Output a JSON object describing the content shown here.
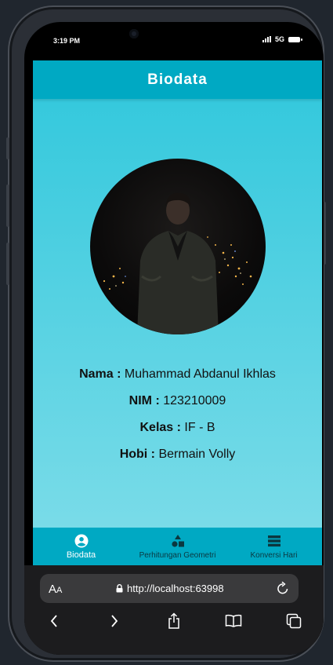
{
  "status": {
    "time": "3:19 PM",
    "network": "5G"
  },
  "appbar": {
    "title": "Biodata"
  },
  "profile": {
    "fields": [
      {
        "label": "Nama :",
        "value": "Muhammad Abdanul Ikhlas"
      },
      {
        "label": "NIM :",
        "value": "123210009"
      },
      {
        "label": "Kelas :",
        "value": "IF - B"
      },
      {
        "label": "Hobi :",
        "value": "Bermain Volly"
      }
    ]
  },
  "nav": {
    "items": [
      {
        "label": "Biodata",
        "icon": "account-circle-icon",
        "active": true
      },
      {
        "label": "Perhitungan Geometri",
        "icon": "shapes-icon",
        "active": false
      },
      {
        "label": "Konversi Hari",
        "icon": "list-bars-icon",
        "active": false
      }
    ]
  },
  "browser": {
    "text_size_big": "A",
    "text_size_small": "A",
    "url": "http://localhost:63998"
  },
  "colors": {
    "appbar": "#00a9c3",
    "background_top": "#2fc7dc",
    "background_bottom": "#7fdde9",
    "nav_active": "#ffffff"
  }
}
